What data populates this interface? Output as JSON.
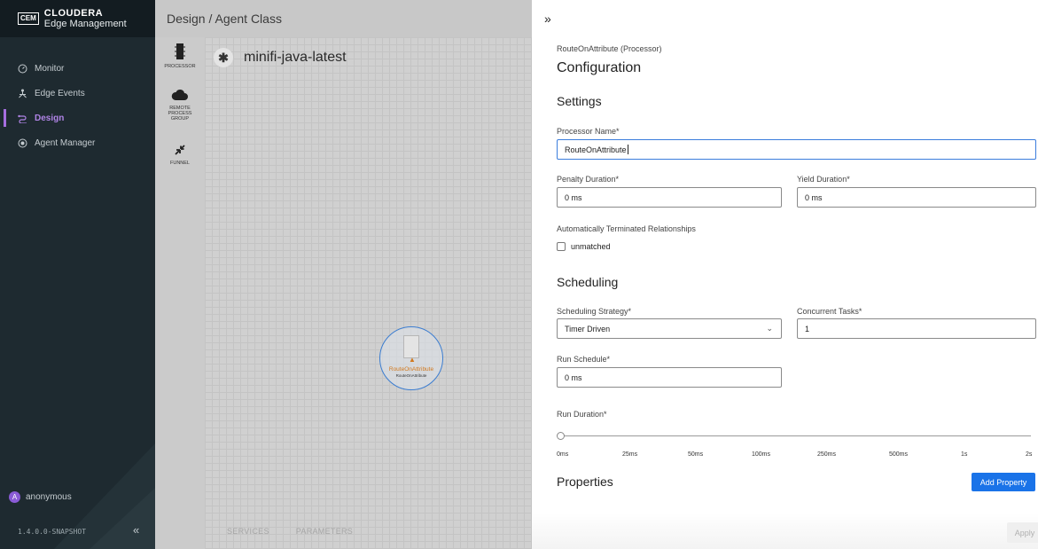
{
  "sidebar": {
    "logo": "CEM",
    "brand_name": "CLOUDERA",
    "brand_sub": "Edge Management",
    "items": [
      {
        "label": "Monitor",
        "icon": "gauge-icon"
      },
      {
        "label": "Edge Events",
        "icon": "events-icon"
      },
      {
        "label": "Design",
        "icon": "design-icon",
        "active": true
      },
      {
        "label": "Agent Manager",
        "icon": "agent-manager-icon"
      }
    ],
    "user": "anonymous",
    "user_initial": "A",
    "version": "1.4.0.0-SNAPSHOT",
    "collapse_glyph": "«"
  },
  "design": {
    "breadcrumb": "Design / Agent Class",
    "palette": [
      {
        "label": "PROCESSOR",
        "icon": "processor-icon"
      },
      {
        "label": "REMOTE PROCESS GROUP",
        "icon": "cloud-icon"
      },
      {
        "label": "FUNNEL",
        "icon": "funnel-icon"
      }
    ],
    "class_name": "minifi-java-latest",
    "class_glyph": "✱",
    "node": {
      "title": "RouteOnAttribute",
      "subtitle": "RouteOnAttribute"
    },
    "bottom_tabs": [
      "SERVICES",
      "PARAMETERS"
    ]
  },
  "panel": {
    "toggle_glyph": "»",
    "subtitle": "RouteOnAttribute (Processor)",
    "title": "Configuration",
    "settings_heading": "Settings",
    "processor_name_label": "Processor Name*",
    "processor_name_value": "RouteOnAttribute",
    "penalty_label": "Penalty Duration*",
    "penalty_value": "0 ms",
    "yield_label": "Yield Duration*",
    "yield_value": "0 ms",
    "auto_term_label": "Automatically Terminated Relationships",
    "auto_term_option": "unmatched",
    "auto_term_checked": false,
    "scheduling_heading": "Scheduling",
    "strategy_label": "Scheduling Strategy*",
    "strategy_value": "Timer Driven",
    "concurrent_label": "Concurrent Tasks*",
    "concurrent_value": "1",
    "run_schedule_label": "Run Schedule*",
    "run_schedule_value": "0 ms",
    "run_duration_label": "Run Duration*",
    "run_duration_ticks": [
      "0ms",
      "25ms",
      "50ms",
      "100ms",
      "250ms",
      "500ms",
      "1s",
      "2s"
    ],
    "run_duration_selected_index": 0,
    "properties_heading": "Properties",
    "add_property_label": "Add Property",
    "apply_label": "Apply"
  },
  "colors": {
    "sidebar_bg": "#1e2a30",
    "accent_purple": "#b084e6",
    "primary_blue": "#1a73e8",
    "warning_orange": "#d1781d"
  }
}
